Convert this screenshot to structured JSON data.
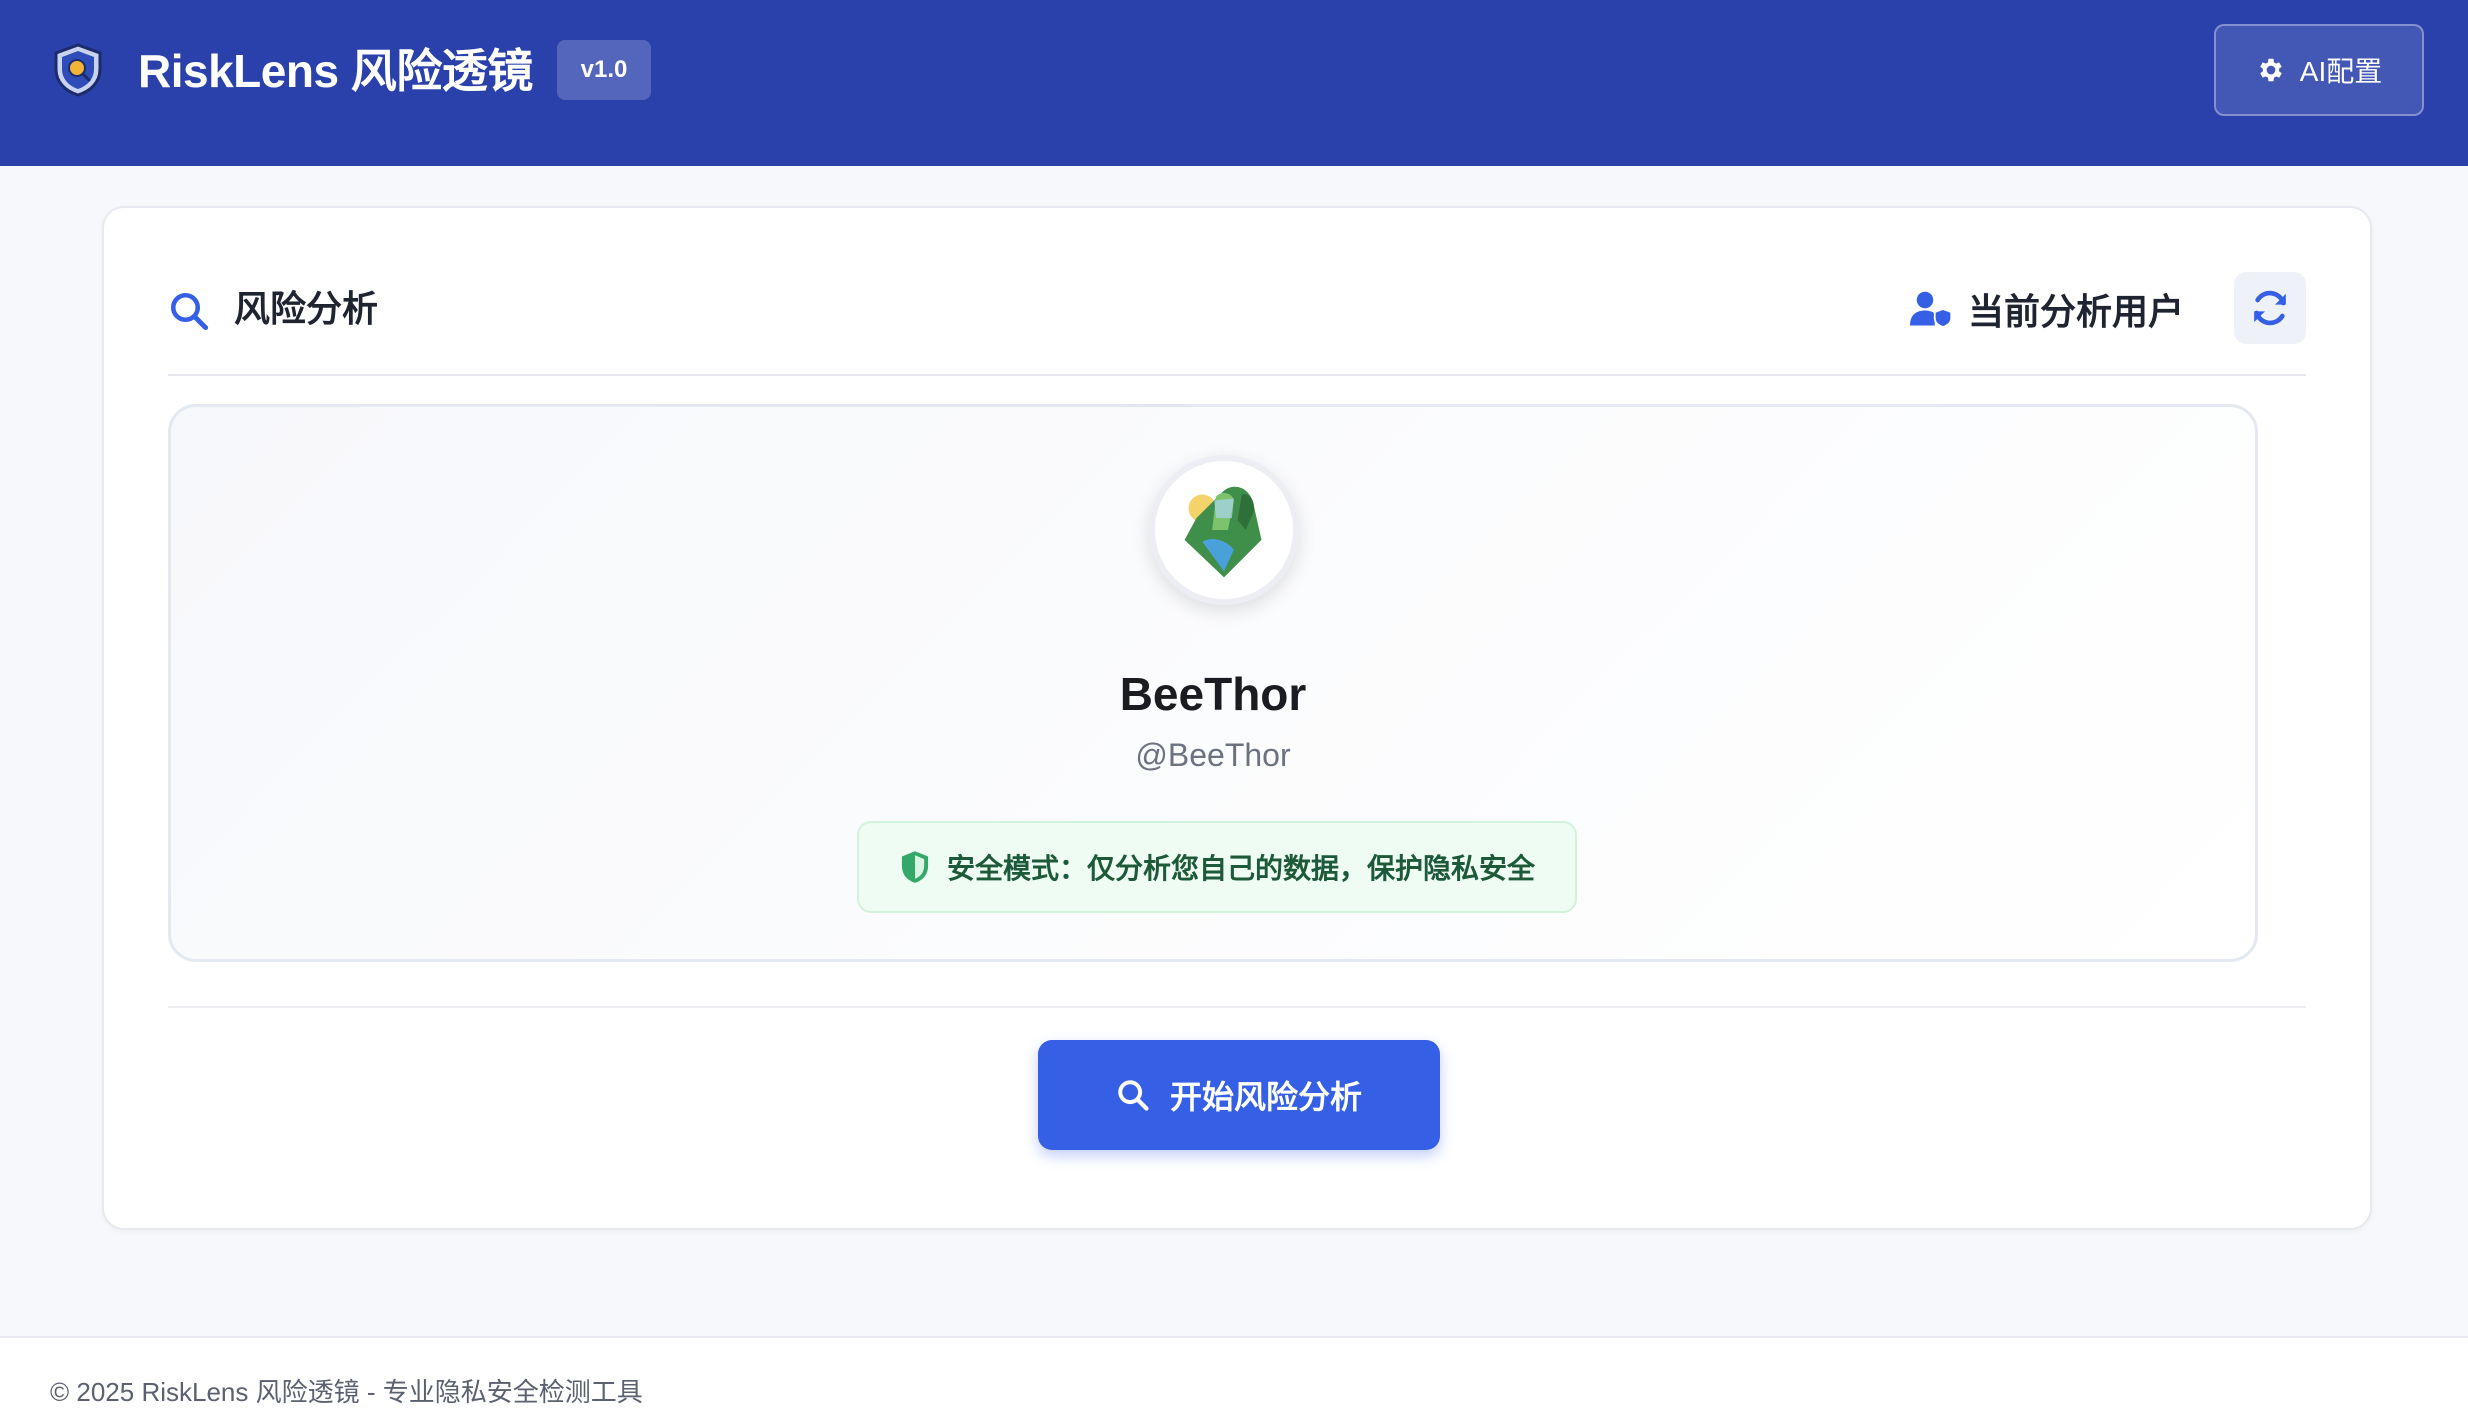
{
  "header": {
    "title": "RiskLens 风险透镜",
    "version": "v1.0",
    "ai_config_label": "AI配置",
    "logo_icon": "shield-search-icon"
  },
  "analysis": {
    "section_title": "风险分析",
    "current_user_label": "当前分析用户",
    "refresh_icon": "refresh-icon"
  },
  "profile": {
    "display_name": "BeeThor",
    "username": "@BeeThor",
    "safe_mode_text": "安全模式：仅分析您自己的数据，保护隐私安全"
  },
  "actions": {
    "start_label": "开始风险分析"
  },
  "footer": {
    "text": "© 2025 RiskLens 风险透镜 - 专业隐私安全检测工具"
  },
  "colors": {
    "header_bg": "#2a40ab",
    "primary": "#3560e6",
    "safe_bg": "#effcf3",
    "safe_text": "#1d5a39"
  }
}
